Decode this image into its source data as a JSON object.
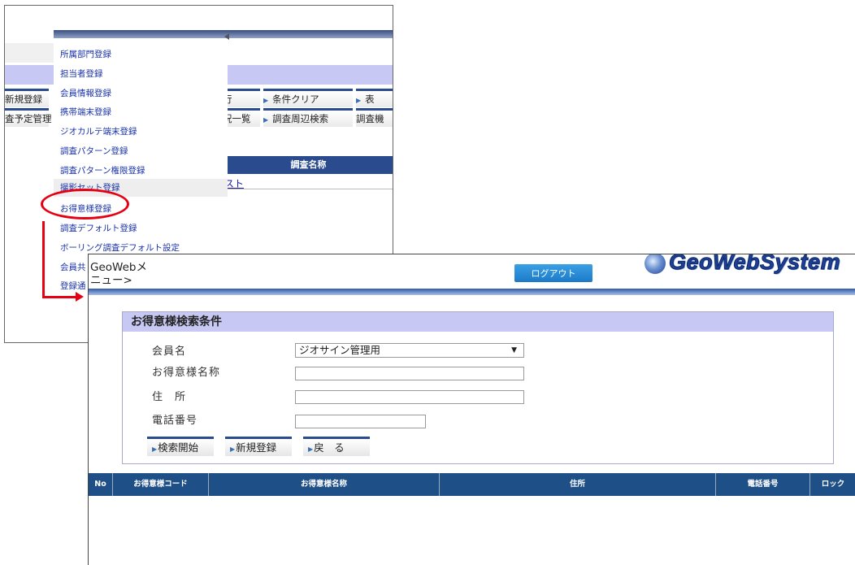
{
  "back_screen": {
    "toolbar": {
      "row1": [
        "新規登録",
        "行",
        "条件クリア",
        "表"
      ],
      "row2": [
        "査予定管理",
        "況一覧",
        "調査周辺検索",
        "調査機"
      ]
    },
    "menu_items": [
      "所属部門登録",
      "担当者登録",
      "会員情報登録",
      "携帯端末登録",
      "ジオカルテ端末登録",
      "調査パターン登録",
      "調査パターン権限登録",
      "撮影セット登録",
      "お得意様登録",
      "調査デフォルト登録",
      "ボーリング調査デフォルト設定",
      "会員共",
      "登録通"
    ],
    "table_header": "調査名称",
    "table_cell": "スト"
  },
  "front_screen": {
    "header": {
      "menu_link": "GeoWebメニュー>",
      "logout_label": "ログアウト",
      "logo_text": "GeoWebSystem"
    },
    "search_panel": {
      "title": "お得意様検索条件",
      "fields": {
        "member_label": "会員名",
        "member_value": "ジオサイン管理用",
        "customer_name_label": "お得意様名称",
        "customer_name_value": "",
        "address_label": "住　所",
        "address_value": "",
        "phone_label": "電話番号",
        "phone_value": ""
      },
      "buttons": {
        "search": "検索開始",
        "new": "新規登録",
        "back": "戻　る"
      }
    },
    "results_table": {
      "columns": [
        "No",
        "お得意様コード",
        "お得意様名称",
        "住所",
        "電話番号",
        "ロック"
      ]
    }
  },
  "colors": {
    "accent_red": "#e60012",
    "header_blue": "#1e4f86",
    "lavender": "#c8c8f4",
    "logout_blue": "#1c7ac8"
  }
}
